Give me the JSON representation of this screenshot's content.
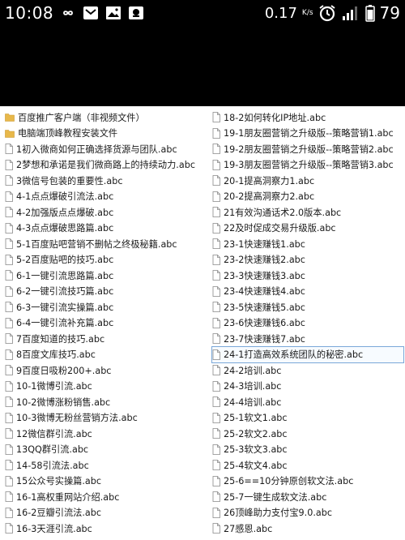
{
  "status_bar": {
    "time": "10:08",
    "network_speed": "0.17",
    "speed_unit": "K/s",
    "battery": "79"
  },
  "left_column": [
    {
      "type": "folder",
      "name": "百度推广客户端（非视频文件）"
    },
    {
      "type": "folder",
      "name": "电脑端顶峰教程安装文件"
    },
    {
      "type": "file",
      "name": "1初入微商如何正确选择货源与团队.abc"
    },
    {
      "type": "file",
      "name": "2梦想和承诺是我们微商路上的持续动力.abc"
    },
    {
      "type": "file",
      "name": "3微信号包装的重要性.abc"
    },
    {
      "type": "file",
      "name": "4-1点点爆破引流法.abc"
    },
    {
      "type": "file",
      "name": "4-2加强版点点爆破.abc"
    },
    {
      "type": "file",
      "name": "4-3点点爆破思路篇.abc"
    },
    {
      "type": "file",
      "name": "5-1百度贴吧营销不删帖之终极秘籍.abc"
    },
    {
      "type": "file",
      "name": "5-2百度贴吧的技巧.abc"
    },
    {
      "type": "file",
      "name": "6-1一键引流思路篇.abc"
    },
    {
      "type": "file",
      "name": "6-2一键引流技巧篇.abc"
    },
    {
      "type": "file",
      "name": "6-3一键引流实操篇.abc"
    },
    {
      "type": "file",
      "name": "6-4一键引流补充篇.abc"
    },
    {
      "type": "file",
      "name": "7百度知道的技巧.abc"
    },
    {
      "type": "file",
      "name": "8百度文库技巧.abc"
    },
    {
      "type": "file",
      "name": "9百度日吸粉200+.abc"
    },
    {
      "type": "file",
      "name": "10-1微博引流.abc"
    },
    {
      "type": "file",
      "name": "10-2微博涨粉销售.abc"
    },
    {
      "type": "file",
      "name": "10-3微博无粉丝营销方法.abc"
    },
    {
      "type": "file",
      "name": "12微信群引流.abc"
    },
    {
      "type": "file",
      "name": "13QQ群引流.abc"
    },
    {
      "type": "file",
      "name": "14-58引流法.abc"
    },
    {
      "type": "file",
      "name": "15公众号实操篇.abc"
    },
    {
      "type": "file",
      "name": "16-1高权重网站介绍.abc"
    },
    {
      "type": "file",
      "name": "16-2豆瓣引流法.abc"
    },
    {
      "type": "file",
      "name": "16-3天涯引流.abc"
    }
  ],
  "right_column": [
    {
      "type": "file",
      "name": "18-2如何转化IP地址.abc"
    },
    {
      "type": "file",
      "name": "19-1朋友圈营销之升级版--策略营销1.abc"
    },
    {
      "type": "file",
      "name": "19-2朋友圈营销之升级版--策略营销2.abc"
    },
    {
      "type": "file",
      "name": "19-3朋友圈营销之升级版--策略营销3.abc"
    },
    {
      "type": "file",
      "name": "20-1提高洞察力1.abc"
    },
    {
      "type": "file",
      "name": "20-2提高洞察力2.abc"
    },
    {
      "type": "file",
      "name": "21有效沟通话术2.0版本.abc"
    },
    {
      "type": "file",
      "name": "22及时促成交易升级版.abc"
    },
    {
      "type": "file",
      "name": "23-1快速赚钱1.abc"
    },
    {
      "type": "file",
      "name": "23-2快速赚钱2.abc"
    },
    {
      "type": "file",
      "name": "23-3快速赚钱3.abc"
    },
    {
      "type": "file",
      "name": "23-4快速赚钱4.abc"
    },
    {
      "type": "file",
      "name": "23-5快速赚钱5.abc"
    },
    {
      "type": "file",
      "name": "23-6快速赚钱6.abc"
    },
    {
      "type": "file",
      "name": "23-7快速赚钱7.abc"
    },
    {
      "type": "file",
      "name": "24-1打造高效系统团队的秘密.abc",
      "selected": true
    },
    {
      "type": "file",
      "name": "24-2培训.abc"
    },
    {
      "type": "file",
      "name": "24-3培训.abc"
    },
    {
      "type": "file",
      "name": "24-4培训.abc"
    },
    {
      "type": "file",
      "name": "25-1软文1.abc"
    },
    {
      "type": "file",
      "name": "25-2软文2.abc"
    },
    {
      "type": "file",
      "name": "25-3软文3.abc"
    },
    {
      "type": "file",
      "name": "25-4软文4.abc"
    },
    {
      "type": "file",
      "name": "25-6==10分钟原创软文法.abc"
    },
    {
      "type": "file",
      "name": "25-7一键生成软文法.abc"
    },
    {
      "type": "file",
      "name": "26顶峰助力支付宝9.0.abc"
    },
    {
      "type": "file",
      "name": "27感恩.abc"
    }
  ],
  "colors": {
    "folder": "#e8b84a",
    "file_border": "#888888",
    "selection": "#7aa7d9"
  },
  "icons": [
    "infinity-icon",
    "mail-icon",
    "image-icon",
    "app-icon",
    "alarm-icon",
    "signal-icon",
    "battery-icon",
    "folder-icon",
    "file-icon"
  ]
}
